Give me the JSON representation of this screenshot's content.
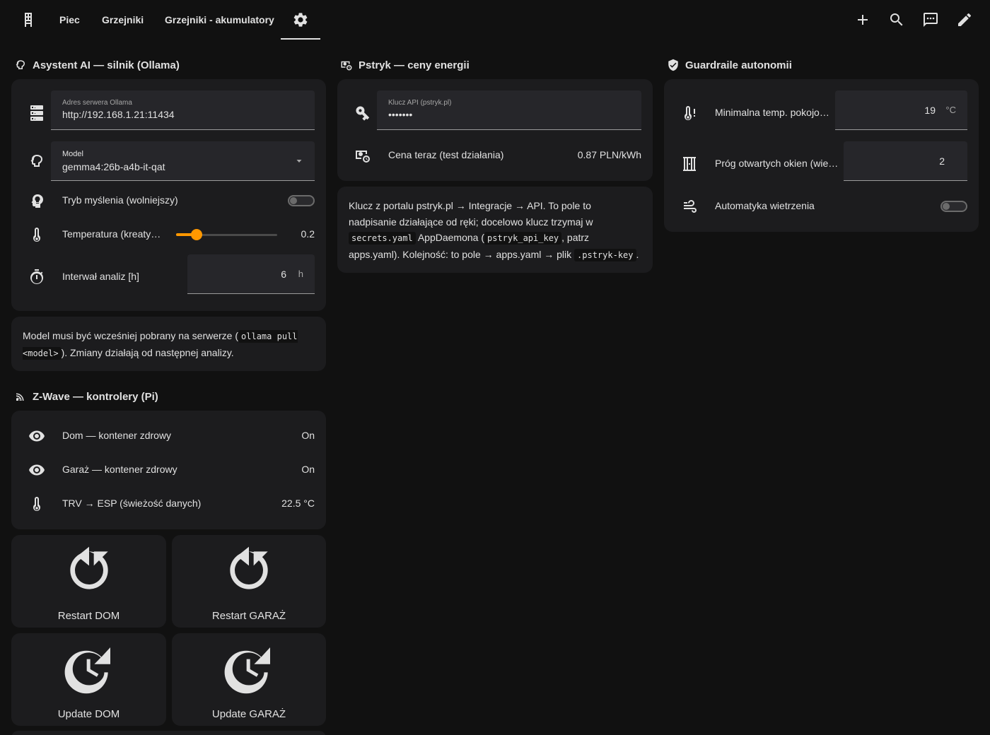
{
  "topbar": {
    "tabs": [
      {
        "label": "Piec"
      },
      {
        "label": "Grzejniki"
      },
      {
        "label": "Grzejniki - akumulatory"
      }
    ]
  },
  "ai": {
    "title": "Asystent AI — silnik (Ollama)",
    "server_label": "Adres serwera Ollama",
    "server_value": "http://192.168.1.21:11434",
    "model_label": "Model",
    "model_value": "gemma4:26b-a4b-it-qat",
    "thinking_label": "Tryb myślenia (wolniejszy)",
    "thinking_on": false,
    "temp_label": "Temperatura (kreaty…",
    "temp_value": "0.2",
    "temp_fraction": 0.2,
    "interval_label": "Interwał analiz [h]",
    "interval_value": "6",
    "interval_unit": "h",
    "note_pre": "Model musi być wcześniej pobrany na serwerze (",
    "note_code": "ollama pull <model>",
    "note_post": "). Zmiany działają od następnej analizy."
  },
  "zwave": {
    "title": "Z-Wave — kontrolery (Pi)",
    "rows": [
      {
        "label": "Dom — kontener zdrowy",
        "value": "On"
      },
      {
        "label": "Garaż — kontener zdrowy",
        "value": "On"
      },
      {
        "label": "TRV → ESP (świeżość danych)",
        "value": "22.5 °C"
      }
    ],
    "buttons": [
      {
        "label": "Restart DOM"
      },
      {
        "label": "Restart GARAŻ"
      },
      {
        "label": "Update DOM"
      },
      {
        "label": "Update GARAŻ"
      }
    ]
  },
  "pstryk": {
    "title": "Pstryk — ceny energii",
    "api_label": "Klucz API (pstryk.pl)",
    "api_value": "•••••••",
    "price_label": "Cena teraz (test działania)",
    "price_value": "0.87 PLN/kWh",
    "note_1": "Klucz z portalu pstryk.pl → Integracje → API. To pole to nadpisanie działające od ręki; docelowo klucz trzymaj w",
    "note_code1": "secrets.yaml",
    "note_2": "AppDaemona (",
    "note_code2": "pstryk_api_key",
    "note_3": ", patrz apps.yaml). Kolejność: to pole → apps.yaml → plik",
    "note_code3": ".pstryk-key",
    "note_4": "."
  },
  "guard": {
    "title": "Guardraile autonomii",
    "min_temp_label": "Minimalna temp. pokojo…",
    "min_temp_value": "19",
    "min_temp_unit": "°C",
    "windows_label": "Próg otwartych okien (wie…",
    "windows_value": "2",
    "ventilation_label": "Automatyka wietrzenia",
    "ventilation_on": false
  },
  "colors": {
    "background": "#111111",
    "card": "#1c1c1e",
    "accent": "#ff9800"
  }
}
